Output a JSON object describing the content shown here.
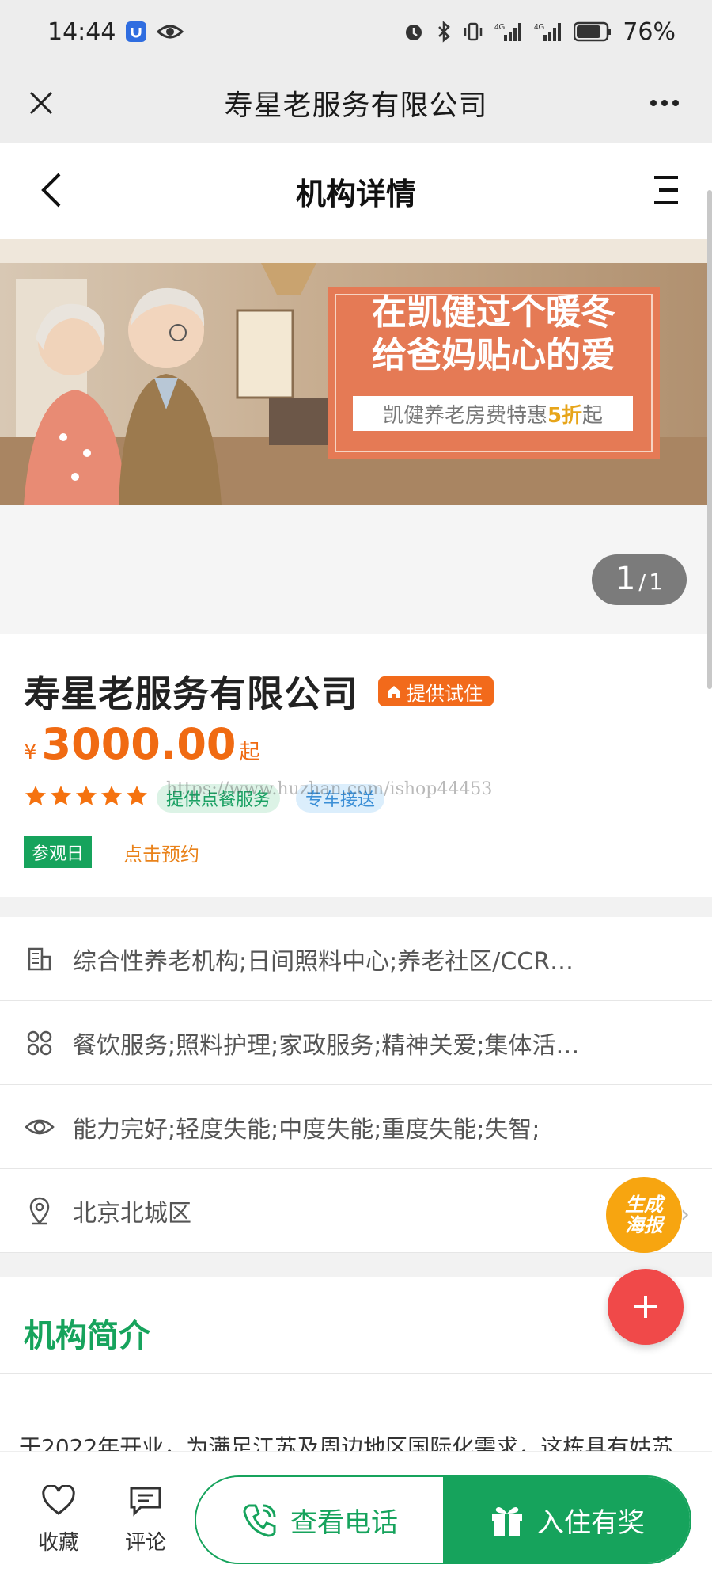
{
  "status_bar": {
    "time": "14:44",
    "battery": "76%"
  },
  "wechat_bar": {
    "title": "寿星老服务有限公司"
  },
  "nav": {
    "title": "机构详情"
  },
  "banner": {
    "headline_1": "在凯健过个暖冬",
    "headline_2": "给爸妈贴心的爱",
    "sub_prefix": "凯健养老房费特惠",
    "sub_highlight": "5折",
    "sub_suffix": "起",
    "pager_current": "1",
    "pager_sep": "/",
    "pager_total": "1"
  },
  "org": {
    "name": "寿星老服务有限公司",
    "trial_badge": "提供试住",
    "price_currency": "¥",
    "price": "3000.00",
    "price_unit": "起",
    "stars": 5,
    "tags": [
      "提供点餐服务",
      "专车接送"
    ],
    "watermark": "https://www.huzhan.com/ishop44453",
    "visit_label": "参观日",
    "book_label": "点击预约"
  },
  "details": [
    {
      "icon": "building-icon",
      "text": "综合性养老机构;日间照料中心;养老社区/CCR…"
    },
    {
      "icon": "grid-icon",
      "text": "餐饮服务;照料护理;家政服务;精神关爱;集体活…"
    },
    {
      "icon": "eye-icon",
      "text": "能力完好;轻度失能;中度失能;重度失能;失智;"
    },
    {
      "icon": "location-pin-icon",
      "text": "北京北城区"
    }
  ],
  "poster_button": {
    "line1": "生成",
    "line2": "海报"
  },
  "intro": {
    "title": "机构简介",
    "text": "于2022年开业，为满足江苏及周边地区国际化需求，这栋具有姑苏"
  },
  "bottom": {
    "favorite": "收藏",
    "comment": "评论",
    "phone": "查看电话",
    "checkin": "入住有奖"
  },
  "colors": {
    "brand_green": "#16a35c",
    "price_orange": "#f06a12",
    "badge_orange": "#f26a1b",
    "fab_red": "#f04949",
    "poster_yellow": "#f7a510"
  }
}
